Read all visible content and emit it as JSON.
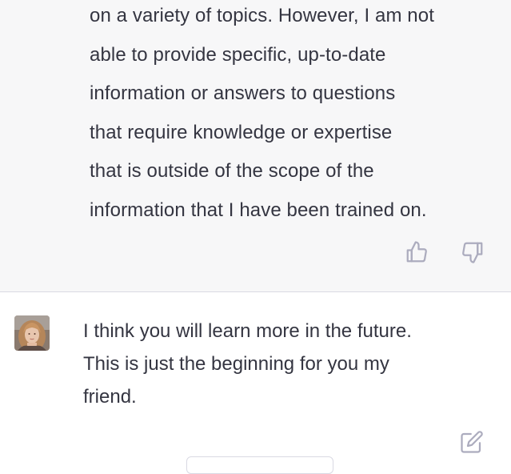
{
  "assistant_message": {
    "lines": [
      "on a variety of topics. However, I am not",
      "able to provide specific, up-to-date",
      "information or answers to questions",
      "that require knowledge or expertise",
      "that is outside of the scope of the",
      "information that I have been trained on."
    ],
    "actions": {
      "thumbs_up_icon": "thumbs-up-icon",
      "thumbs_down_icon": "thumbs-down-icon"
    }
  },
  "user_message": {
    "lines": [
      "I think you will learn more in the future.",
      "This is just the beginning for you my",
      "friend."
    ],
    "edit_icon": "edit-icon"
  },
  "colors": {
    "assistant_bg": "#f7f7f8",
    "user_bg": "#ffffff",
    "text": "#343541",
    "icon": "#acacbe",
    "divider": "#d9d9e3"
  }
}
